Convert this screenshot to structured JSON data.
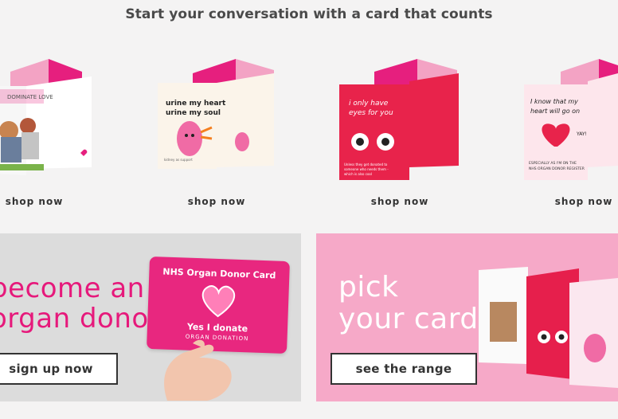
{
  "header": {
    "title": "Start your conversation with a card that counts"
  },
  "cards": [
    {
      "shop_label": "shop now",
      "card_text": "DOMINATE LOVE"
    },
    {
      "shop_label": "shop now",
      "card_text_line1": "urine my heart",
      "card_text_line2": "urine my soul",
      "card_small": "kidney as support"
    },
    {
      "shop_label": "shop now",
      "card_text_line1": "i only have",
      "card_text_line2": "eyes for you",
      "card_small": "Unless they get donated to someone who needs them - which is also cool"
    },
    {
      "shop_label": "shop now",
      "card_text_line1": "I know that my",
      "card_text_line2": "heart will go on",
      "card_small_line1": "ESPECIALLY AS I'M ON THE",
      "card_small_line2": "NHS ORGAN DONOR REGISTER",
      "card_yay": "YAY!"
    }
  ],
  "promo_left": {
    "heading_line1": "become an",
    "heading_line2": "organ donor",
    "button_label": "sign up now",
    "donor_card_title": "NHS Organ Donor Card",
    "donor_card_yes": "Yes I donate",
    "donor_card_sub": "ORGAN DONATION"
  },
  "promo_right": {
    "heading_line1": "pick",
    "heading_line2": "your card",
    "button_label": "see the range"
  },
  "colors": {
    "pink": "#e6197b",
    "light_pink": "#f6a9c8",
    "magenta": "#e8277f"
  }
}
